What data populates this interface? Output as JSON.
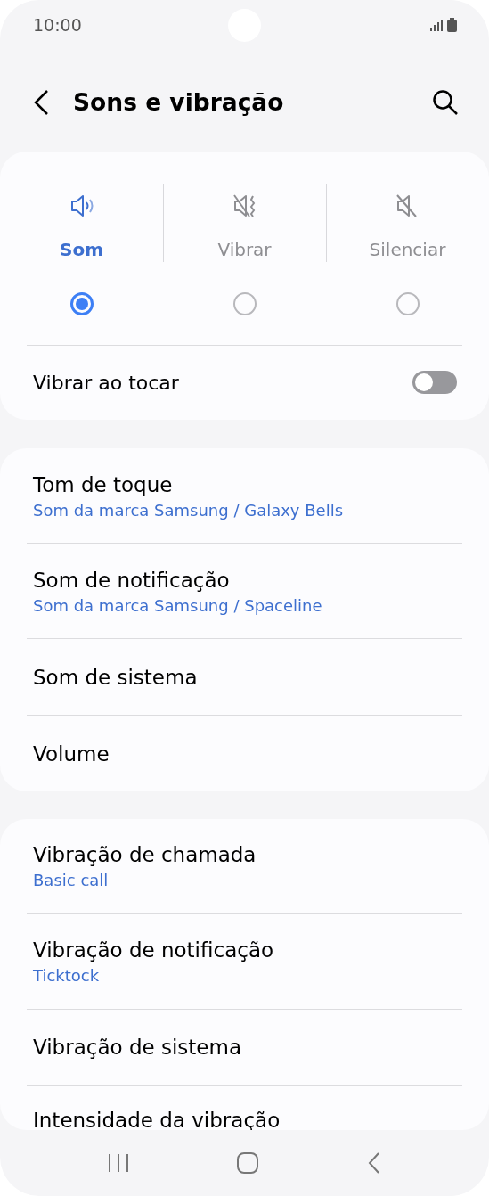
{
  "status_bar": {
    "time": "10:00"
  },
  "header": {
    "title": "Sons e vibração"
  },
  "modes": [
    {
      "label": "Som",
      "kind": "sound",
      "selected": true
    },
    {
      "label": "Vibrar",
      "kind": "vibrate",
      "selected": false
    },
    {
      "label": "Silenciar",
      "kind": "mute",
      "selected": false
    }
  ],
  "toggle": {
    "label": "Vibrar ao tocar",
    "on": false
  },
  "groups": [
    {
      "items": [
        {
          "title": "Tom de toque",
          "subtitle": "Som da marca Samsung / Galaxy Bells"
        },
        {
          "title": "Som de notificação",
          "subtitle": "Som da marca Samsung / Spaceline"
        },
        {
          "title": "Som de sistema"
        },
        {
          "title": "Volume"
        }
      ]
    },
    {
      "items": [
        {
          "title": "Vibração de chamada",
          "subtitle": "Basic call"
        },
        {
          "title": "Vibração de notificação",
          "subtitle": "Ticktock"
        },
        {
          "title": "Vibração de sistema"
        },
        {
          "title": "Intensidade da vibração"
        }
      ]
    }
  ]
}
